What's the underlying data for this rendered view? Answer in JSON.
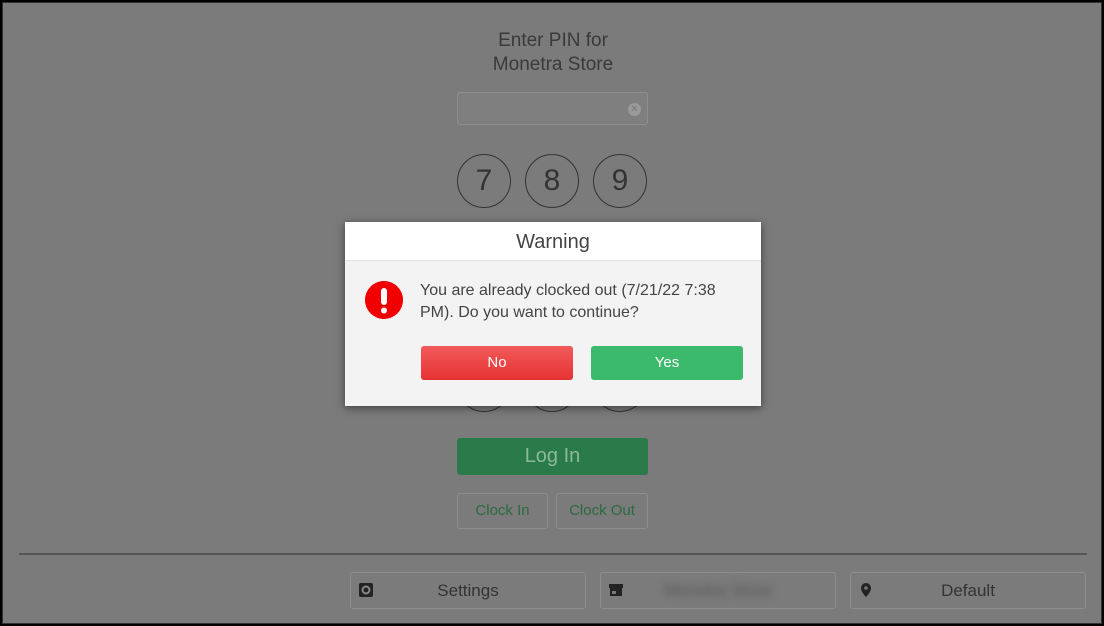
{
  "header": {
    "line1": "Enter PIN for",
    "line2": "Monetra Store"
  },
  "pin_input": {
    "value": ""
  },
  "keypad": {
    "row1": [
      "7",
      "8",
      "9"
    ]
  },
  "login_label": "Log In",
  "clock_in_label": "Clock In",
  "clock_out_label": "Clock Out",
  "footer": {
    "settings_label": "Settings",
    "store_label": "Monetra Store",
    "location_label": "Default"
  },
  "dialog": {
    "title": "Warning",
    "message": "You are already clocked out (7/21/22 7:38 PM). Do you want to continue?",
    "no_label": "No",
    "yes_label": "Yes",
    "icon": "exclamation-circle-icon"
  },
  "colors": {
    "no": "#e63232",
    "yes": "#3cba6c",
    "warning": "#f00000",
    "login": "#2b7a49"
  }
}
